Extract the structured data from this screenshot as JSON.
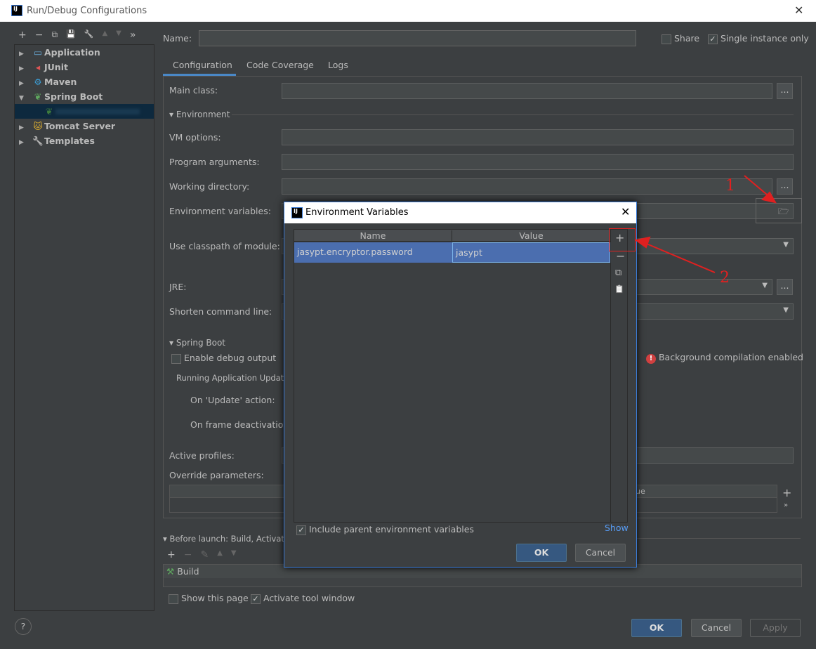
{
  "window": {
    "title": "Run/Debug Configurations",
    "close": "✕"
  },
  "toolbar": {
    "add": "+",
    "remove": "−",
    "copy": "⧉",
    "save": "💾",
    "edit": "🔧",
    "up": "▲",
    "down": "▼",
    "more": "»"
  },
  "tree": [
    {
      "label": "Application",
      "icon": "application-icon",
      "expanded": false
    },
    {
      "label": "JUnit",
      "icon": "junit-icon",
      "expanded": false
    },
    {
      "label": "Maven",
      "icon": "gear-icon",
      "expanded": false
    },
    {
      "label": "Spring Boot",
      "icon": "spring-boot-icon",
      "expanded": true
    },
    {
      "label": "",
      "icon": "spring-boot-icon",
      "selected": true
    },
    {
      "label": "Tomcat Server",
      "icon": "tomcat-icon",
      "expanded": false
    },
    {
      "label": "Templates",
      "icon": "wrench-icon",
      "expanded": false
    }
  ],
  "name_label": "Name:",
  "share_label": "Share",
  "single_instance_label": "Single instance only",
  "single_instance_checked": true,
  "tabs": [
    {
      "label": "Configuration",
      "active": true
    },
    {
      "label": "Code Coverage"
    },
    {
      "label": "Logs"
    }
  ],
  "form": {
    "main_class": "Main class:",
    "environment": "Environment",
    "vm_options": "VM options:",
    "program_arguments": "Program arguments:",
    "working_directory": "Working directory:",
    "environment_variables": "Environment variables:",
    "use_classpath": "Use classpath of module:",
    "jre": "JRE:",
    "shorten": "Shorten command line:",
    "spring_boot": "Spring Boot",
    "enable_debug": "Enable debug output",
    "background_compilation": "Background compilation enabled",
    "running_update": "Running Application Update",
    "on_update": "On 'Update' action:",
    "on_frame": "On frame deactivation:",
    "active_profiles": "Active profiles:",
    "override_parameters": "Override parameters:",
    "override_value_col": "ue",
    "browse": "...",
    "add": "+",
    "more": "»"
  },
  "before_launch": {
    "title": "Before launch: Build, Activate t",
    "tasks": [
      "Build"
    ],
    "show_page": "Show this page",
    "activate_tool": "Activate tool window",
    "activate_checked": true
  },
  "buttons": {
    "ok": "OK",
    "cancel": "Cancel",
    "apply": "Apply",
    "help": "?"
  },
  "modal": {
    "title": "Environment Variables",
    "close": "✕",
    "columns": [
      "Name",
      "Value"
    ],
    "rows": [
      {
        "name": "jasypt.encryptor.password",
        "value": "jasypt"
      }
    ],
    "side_buttons": {
      "add": "+",
      "remove": "−",
      "copy": "⧉",
      "paste": "📋"
    },
    "include_parent": "Include parent environment variables",
    "include_checked": true,
    "show": "Show",
    "ok": "OK",
    "cancel": "Cancel"
  },
  "annotations": {
    "step1": "1",
    "step2": "2",
    "color": "#e02020"
  },
  "colors": {
    "background": "#3c3f41",
    "selection": "#4b6eaf",
    "primary_button": "#365880",
    "link": "#589df6"
  }
}
